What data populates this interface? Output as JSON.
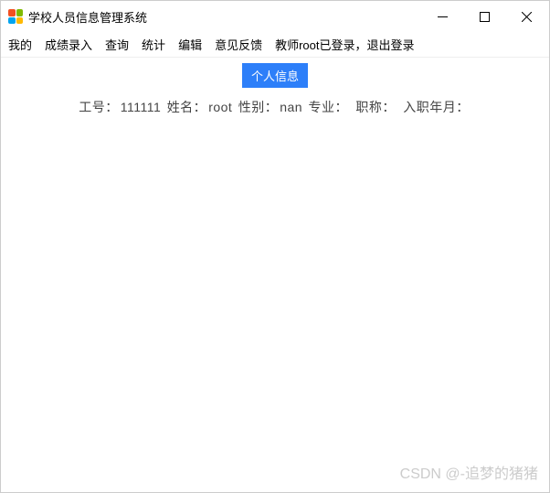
{
  "window": {
    "title": "学校人员信息管理系统"
  },
  "menubar": {
    "items": [
      "我的",
      "成绩录入",
      "查询",
      "统计",
      "编辑",
      "意见反馈"
    ],
    "status": "教师root已登录，退出登录"
  },
  "content": {
    "heading": "个人信息",
    "labels": {
      "id": "工号：",
      "name": "姓名：",
      "gender": "性别：",
      "major": "专业：",
      "title": "职称：",
      "hire_date": "入职年月："
    },
    "values": {
      "id": "111111",
      "name": "root",
      "gender": "nan",
      "major": "",
      "title": "",
      "hire_date": ""
    }
  },
  "watermark": "CSDN @-追梦的猪猪"
}
